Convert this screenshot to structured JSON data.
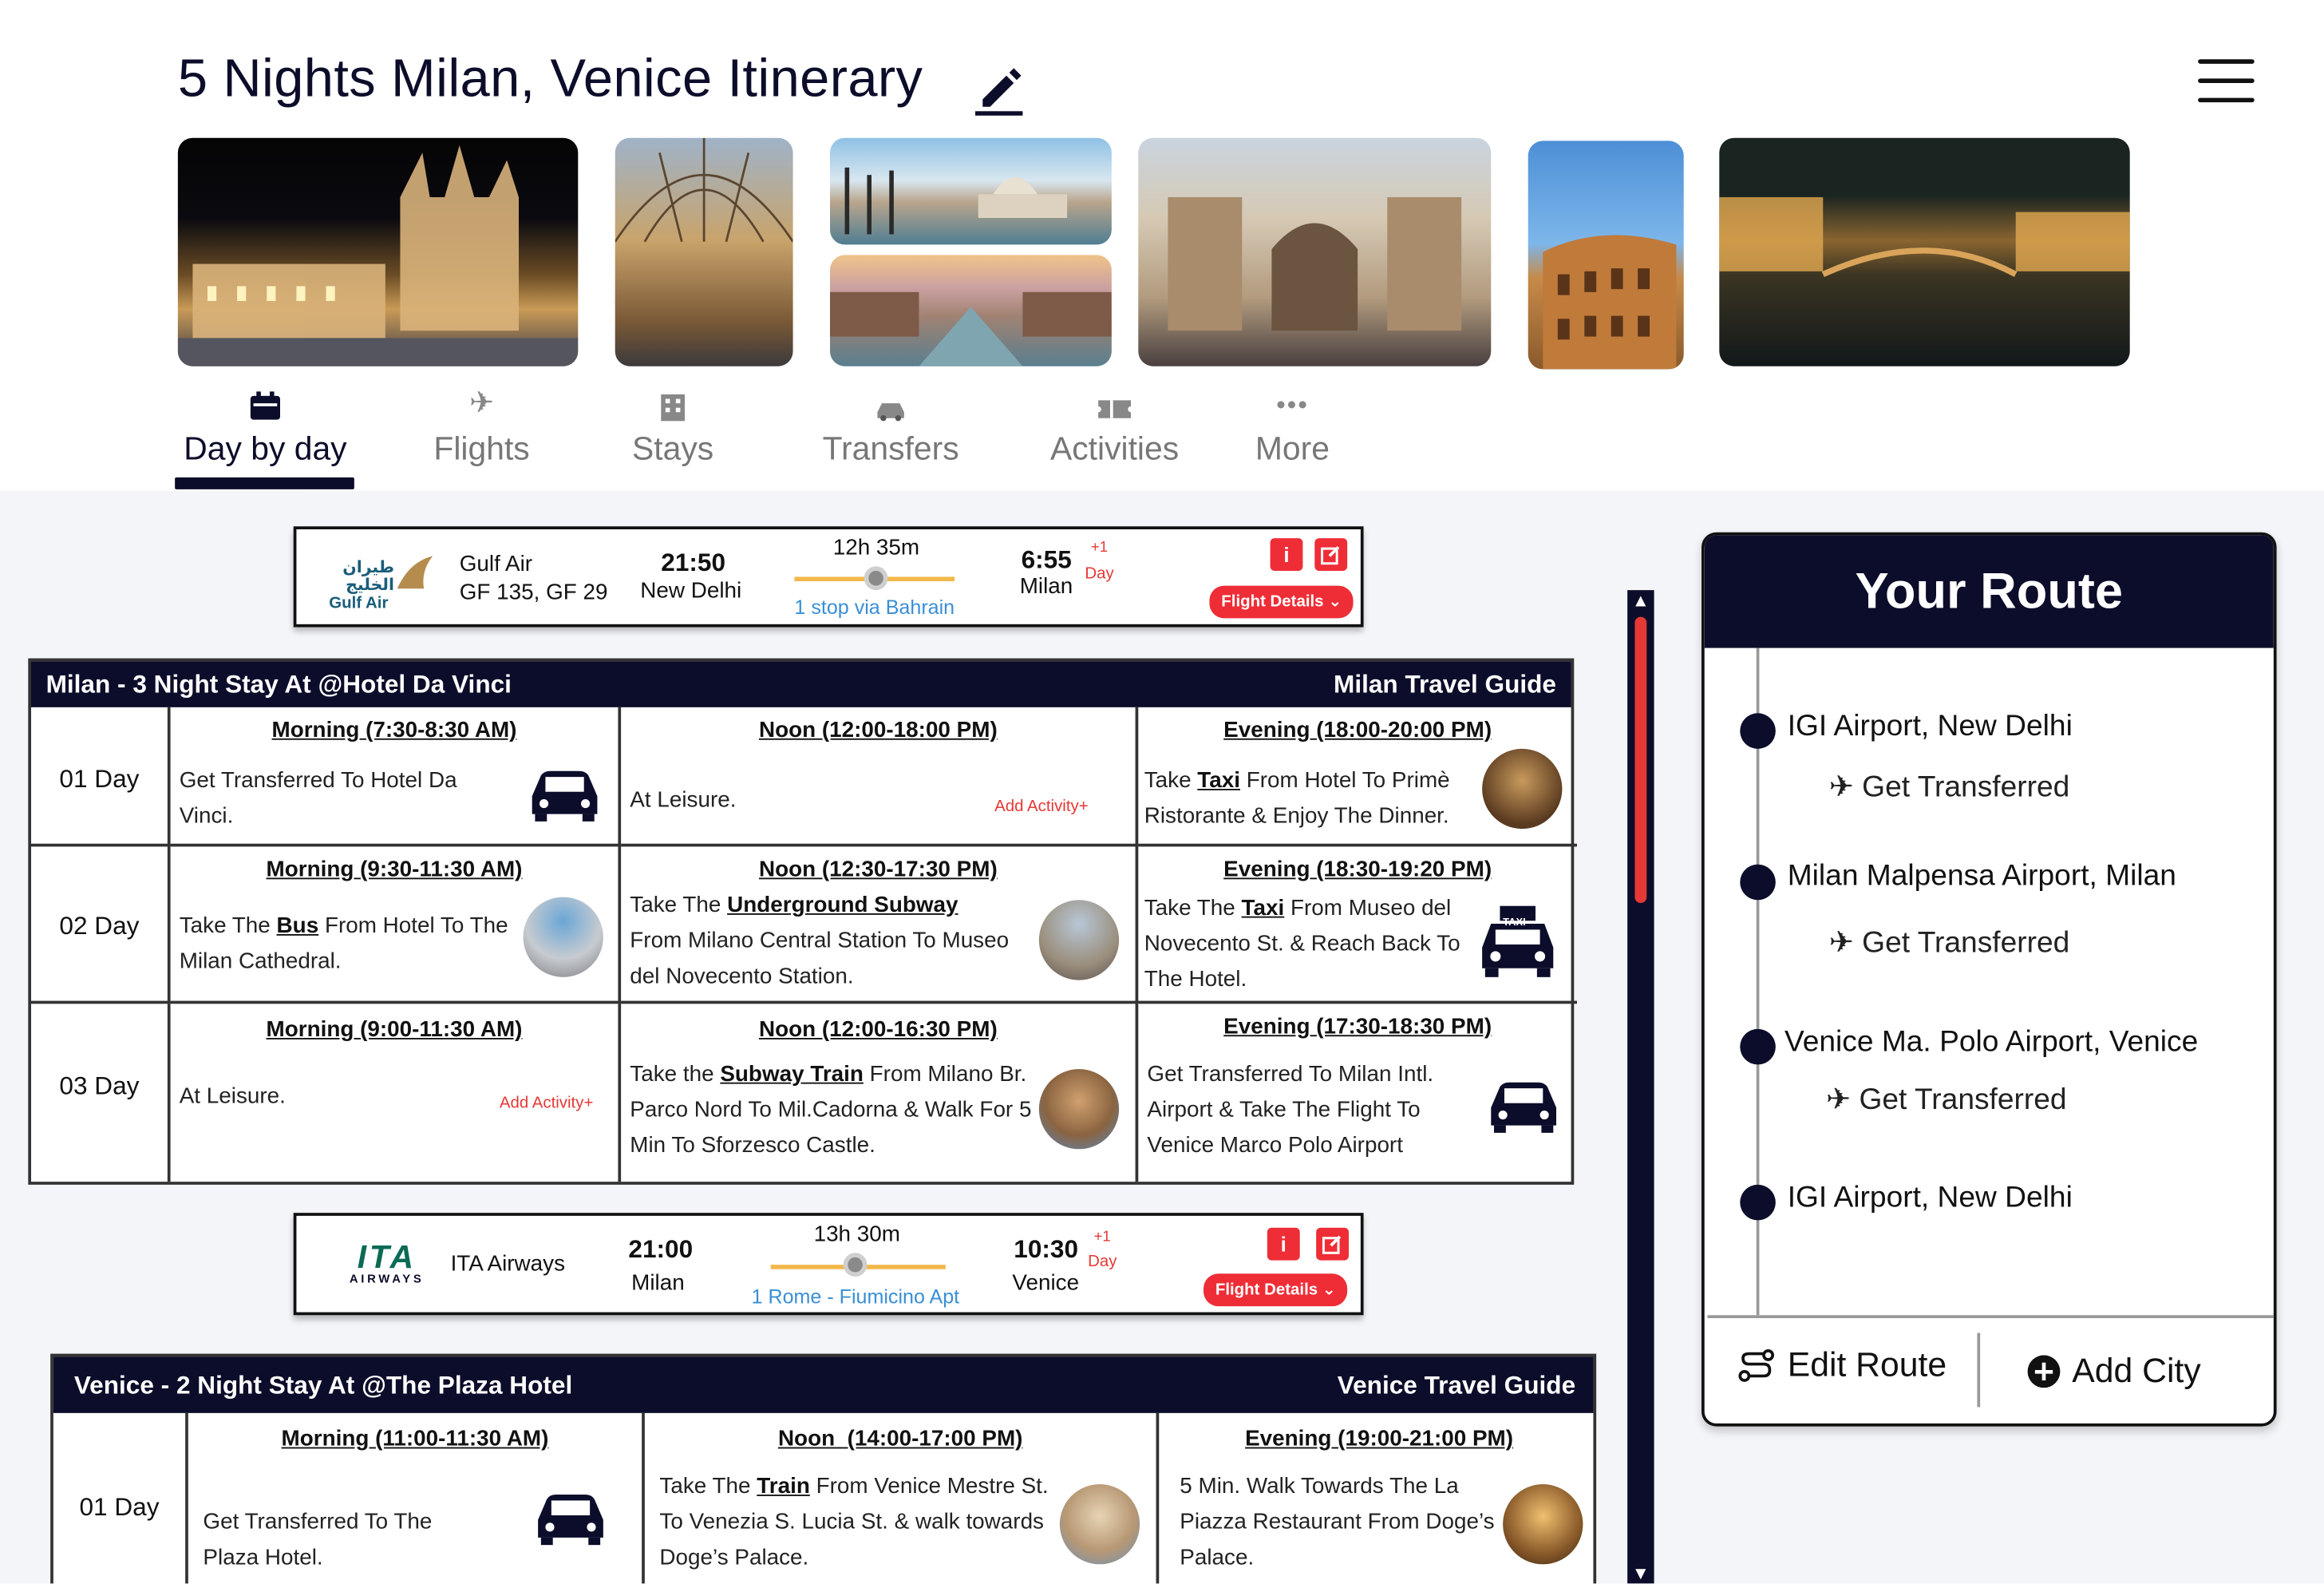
{
  "title": "5 Nights Milan, Venice Itinerary",
  "tabs": [
    {
      "label": "Day by day",
      "icon": "calendar-icon"
    },
    {
      "label": "Flights",
      "icon": "plane-icon"
    },
    {
      "label": "Stays",
      "icon": "hotel-icon"
    },
    {
      "label": "Transfers",
      "icon": "car-icon"
    },
    {
      "label": "Activities",
      "icon": "ticket-icon"
    },
    {
      "label": "More",
      "icon": "more-icon"
    }
  ],
  "flight1": {
    "airline_logo": "طيران الخليج",
    "airline_logo_en": "Gulf Air",
    "airline": "Gulf Air",
    "codes": "GF 135, GF 29",
    "dep_time": "21:50",
    "dep_city": "New Delhi",
    "duration": "12h 35m",
    "stops": "1 stop via Bahrain",
    "arr_time": "6:55",
    "plus": "+1",
    "day": "Day",
    "arr_city": "Milan",
    "details": "Flight Details",
    "info": "i"
  },
  "stay1": {
    "title": "Milan - 3 Night Stay At @Hotel Da Vinci",
    "guide": "Milan Travel Guide",
    "days": [
      {
        "label": "01 Day",
        "morning": {
          "slot": "Morning (7:30-8:30 AM)",
          "text": "Get Transferred To Hotel Da Vinci."
        },
        "noon": {
          "slot": "Noon (12:00-18:00 PM)",
          "text": "At Leisure.",
          "add": "Add Activity+"
        },
        "evening": {
          "slot": "Evening (18:00-20:00 PM)",
          "pre": "Take ",
          "bold": "Taxi",
          "post": " From Hotel To Primè Ristorante & Enjoy The Dinner."
        }
      },
      {
        "label": "02 Day",
        "morning": {
          "slot": "Morning (9:30-11:30 AM)",
          "pre": "Take The ",
          "bold": "Bus",
          "post": " From Hotel To The Milan Cathedral."
        },
        "noon": {
          "slot": "Noon (12:30-17:30 PM)",
          "pre": "Take The ",
          "bold": "Underground Subway",
          "post": " From Milano Central Station To Museo del Novecento Station."
        },
        "evening": {
          "slot": "Evening (18:30-19:20 PM)",
          "pre": "Take The ",
          "bold": "Taxi",
          "post": " From Museo del Novecento St. & Reach Back To The Hotel.",
          "taxi": "TAXI"
        }
      },
      {
        "label": "03 Day",
        "morning": {
          "slot": "Morning (9:00-11:30 AM)",
          "text": "At Leisure.",
          "add": "Add Activity+"
        },
        "noon": {
          "slot": "Noon (12:00-16:30 PM)",
          "pre": "Take the ",
          "bold": "Subway Train",
          "post": " From Milano Br. Parco Nord To Mil.Cadorna & Walk For 5 Min To Sforzesco Castle."
        },
        "evening": {
          "slot": "Evening (17:30-18:30 PM)",
          "text": "Get Transferred To Milan Intl. Airport & Take The Flight To Venice Marco Polo Airport"
        }
      }
    ]
  },
  "flight2": {
    "airline_logo": "ITA",
    "airline_logo_sub": "AIRWAYS",
    "airline": "ITA Airways",
    "dep_time": "21:00",
    "dep_city": "Milan",
    "duration": "13h 30m",
    "stops": "1 Rome - Fiumicino Apt",
    "arr_time": "10:30",
    "plus": "+1",
    "day": "Day",
    "arr_city": "Venice",
    "details": "Flight Details",
    "info": "i"
  },
  "stay2": {
    "title": "Venice - 2 Night Stay At @The Plaza Hotel",
    "guide": "Venice Travel Guide",
    "days": [
      {
        "label": "01 Day",
        "morning": {
          "slot": "Morning (11:00-11:30 AM)",
          "text": "Get Transferred To The Plaza Hotel."
        },
        "noon": {
          "slot": "Noon  (14:00-17:00 PM)",
          "pre": "Take The ",
          "bold": "Train",
          "post": " From Venice Mestre St. To Venezia S. Lucia St. & walk towards Doge’s Palace."
        },
        "evening": {
          "slot": "Evening (19:00-21:00 PM)",
          "text": "5 Min. Walk Towards The La Piazza Restaurant From Doge’s Palace."
        }
      }
    ]
  },
  "route": {
    "title": "Your Route",
    "stops": [
      {
        "city": "IGI Airport, New Delhi",
        "transfer": "Get Transferred"
      },
      {
        "city": "Milan Malpensa Airport, Milan",
        "transfer": "Get Transferred"
      },
      {
        "city": "Venice Ma. Polo Airport, Venice",
        "transfer": "Get Transferred"
      },
      {
        "city": "IGI Airport, New Delhi"
      }
    ],
    "edit": "Edit Route",
    "add": "Add City"
  },
  "colors": {
    "navy": "#0c0d2a",
    "accent_red": "#ee2d36",
    "link_blue": "#3a8fd6"
  }
}
